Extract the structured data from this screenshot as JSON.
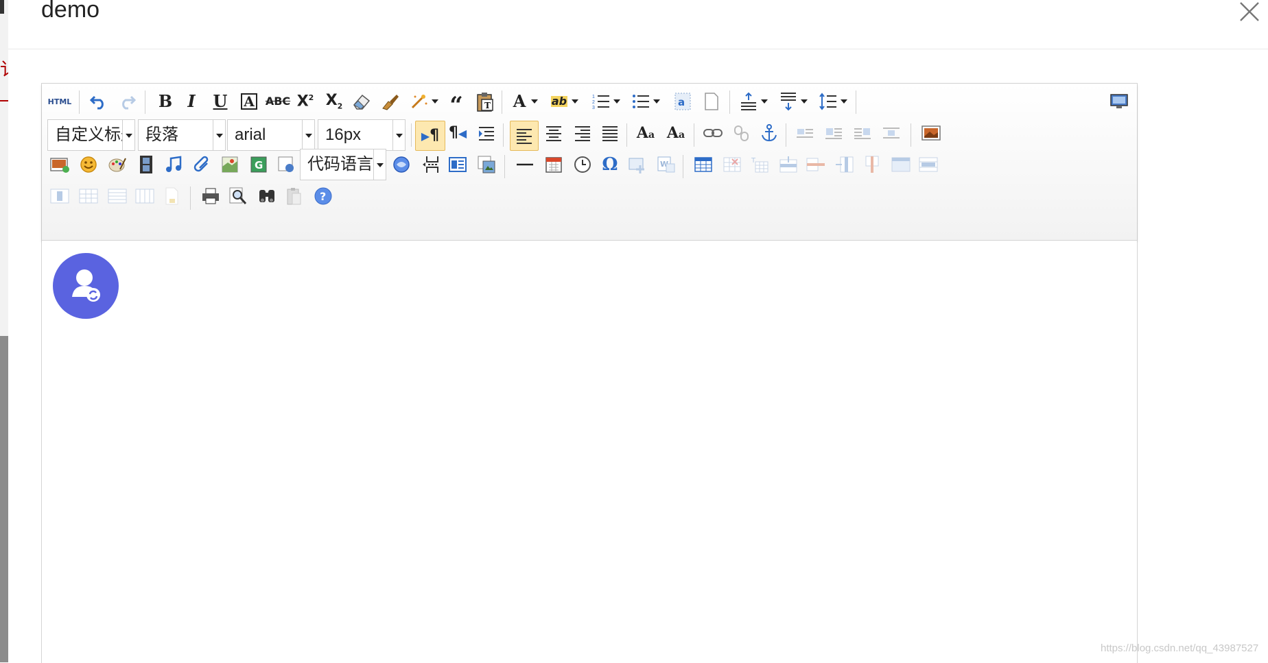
{
  "modal": {
    "title": "demo",
    "close_icon": "close-icon"
  },
  "toolbar": {
    "row1": [
      "html-source-icon",
      "undo-icon",
      "redo-icon",
      "bold-icon",
      "italic-icon",
      "underline-icon",
      "font-border-icon",
      "strikethrough-icon",
      "superscript-icon",
      "subscript-icon",
      "eraser-icon",
      "format-painter-icon",
      "auto-typeset-icon",
      "blockquote-icon",
      "paste-plain-icon",
      "font-color-icon",
      "highlight-color-icon",
      "ordered-list-icon",
      "unordered-list-icon",
      "select-all-icon",
      "clear-doc-icon",
      "row-spacing-top-icon",
      "row-spacing-bottom-icon",
      "line-height-icon",
      "preview-icon"
    ],
    "heading_combo": "自定义标题",
    "paragraph_combo": "段落",
    "font_family_combo": "arial",
    "font_size_combo": "16px",
    "code_language_combo": "代码语言",
    "row2": [
      "direction-ltr-icon",
      "direction-rtl-icon",
      "indent-icon",
      "align-left-icon",
      "align-center-icon",
      "align-right-icon",
      "justify-icon",
      "to-uppercase-icon",
      "to-lowercase-icon",
      "link-icon",
      "unlink-icon",
      "anchor-icon",
      "image-none-icon",
      "image-left-icon",
      "image-right-icon",
      "image-center-icon",
      "insert-image-icon"
    ],
    "row3": [
      "multi-image-icon",
      "emotion-icon",
      "scrawl-icon",
      "video-icon",
      "music-icon",
      "attachment-icon",
      "map-icon",
      "google-map-icon",
      "insert-frame-icon",
      "code-insert-icon",
      "page-break-icon",
      "template-icon",
      "background-icon",
      "horizontal-rule-icon",
      "date-icon",
      "time-icon",
      "special-chars-icon",
      "snapscreen-icon",
      "word-image-icon",
      "insert-table-icon",
      "delete-table-icon",
      "insert-paragraph-before-table-icon",
      "insert-row-icon",
      "delete-row-icon",
      "insert-col-icon",
      "delete-col-icon",
      "merge-cells-icon",
      "merge-right-icon"
    ],
    "row4": [
      "merge-down-icon",
      "split-to-cells-icon",
      "split-to-rows-icon",
      "split-to-cols-icon",
      "chart-icon",
      "print-icon",
      "search-replace-icon",
      "find-icon",
      "draft-icon",
      "help-icon"
    ],
    "colors": {
      "accent_active": "#fde8b0",
      "avatar": "#5a63e0",
      "help": "#5b8de8"
    }
  },
  "watermark": "https://blog.csdn.net/qq_43987527"
}
